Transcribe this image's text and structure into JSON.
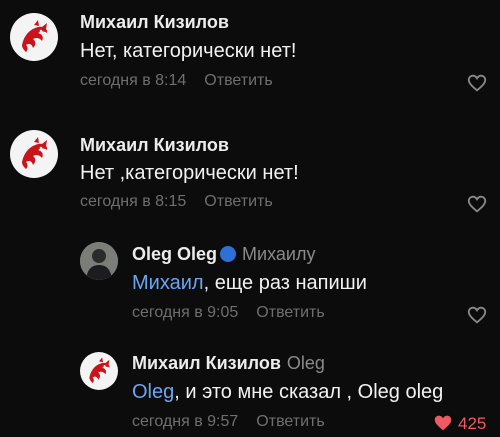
{
  "comments": [
    {
      "author": "Михаил Кизилов",
      "text": "Нет, категорически нет!",
      "time": "сегодня в 8:14",
      "reply_label": "Ответить"
    },
    {
      "author": "Михаил Кизилов",
      "text": "Нет ,категорически нет!",
      "time": "сегодня в 8:15",
      "reply_label": "Ответить"
    },
    {
      "author": "Oleg Oleg",
      "reply_to": "Михаилу",
      "mention": "Михаил",
      "text": ", еще раз напиши",
      "time": "сегодня в 9:05",
      "reply_label": "Ответить"
    },
    {
      "author": "Михаил Кизилов",
      "reply_to": "Oleg",
      "mention": "Oleg",
      "text": ", и это мне сказал , Oleg oleg",
      "time": "сегодня в 9:57",
      "reply_label": "Ответить",
      "likes": "425"
    }
  ],
  "colors": {
    "background": "#0c0c0d",
    "mention": "#6aa6f0",
    "like_active": "#ef5a62",
    "muted": "#6f6f6f"
  },
  "icons": {
    "like": "heart-outline-icon",
    "liked": "heart-filled-icon",
    "avatar_dragon": "red-dragon-avatar",
    "verified": "shield-badge-icon"
  }
}
